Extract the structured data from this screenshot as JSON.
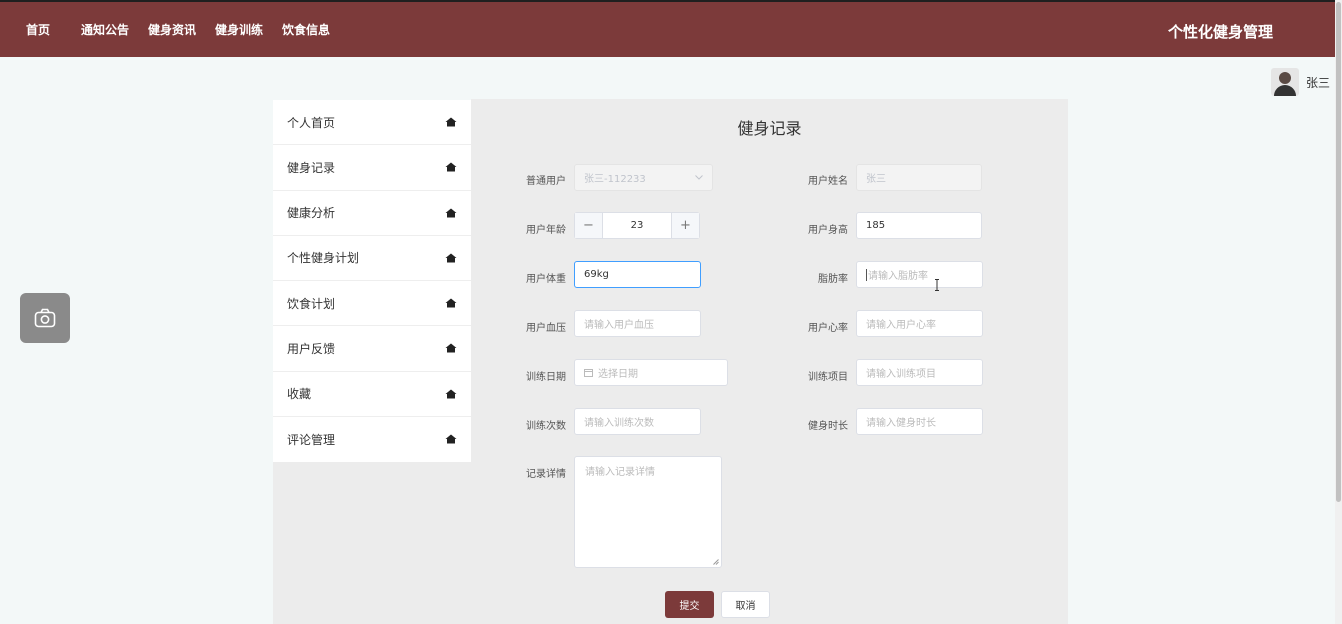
{
  "nav": {
    "items": [
      {
        "label": "首页"
      },
      {
        "label": "通知公告"
      },
      {
        "label": "健身资讯"
      },
      {
        "label": "健身训练"
      },
      {
        "label": "饮食信息"
      }
    ],
    "site_title": "个性化健身管理"
  },
  "user": {
    "name": "张三"
  },
  "sidebar": {
    "items": [
      {
        "label": "个人首页"
      },
      {
        "label": "健身记录"
      },
      {
        "label": "健康分析"
      },
      {
        "label": "个性健身计划"
      },
      {
        "label": "饮食计划"
      },
      {
        "label": "用户反馈"
      },
      {
        "label": "收藏"
      },
      {
        "label": "评论管理"
      }
    ]
  },
  "form": {
    "title": "健身记录",
    "user_type": {
      "label": "普通用户",
      "value": "张三-112233"
    },
    "user_name": {
      "label": "用户姓名",
      "value": "张三"
    },
    "age": {
      "label": "用户年龄",
      "value": "23",
      "minus": "−",
      "plus": "+"
    },
    "height": {
      "label": "用户身高",
      "value": "185"
    },
    "weight": {
      "label": "用户体重",
      "value": "69kg"
    },
    "body_fat": {
      "label": "脂肪率",
      "placeholder": "请输入脂肪率"
    },
    "blood_pressure": {
      "label": "用户血压",
      "placeholder": "请输入用户血压"
    },
    "heart_rate": {
      "label": "用户心率",
      "placeholder": "请输入用户心率"
    },
    "train_date": {
      "label": "训练日期",
      "placeholder": "选择日期"
    },
    "train_item": {
      "label": "训练项目",
      "placeholder": "请输入训练项目"
    },
    "train_count": {
      "label": "训练次数",
      "placeholder": "请输入训练次数"
    },
    "duration": {
      "label": "健身时长",
      "placeholder": "请输入健身时长"
    },
    "detail": {
      "label": "记录详情",
      "placeholder": "请输入记录详情"
    },
    "submit_label": "提交",
    "cancel_label": "取消"
  }
}
